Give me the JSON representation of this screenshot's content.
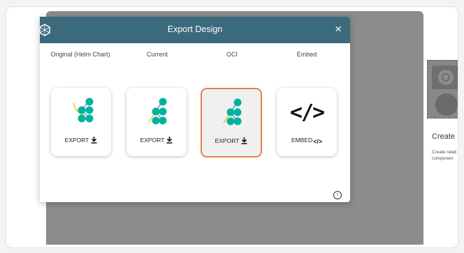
{
  "background": {
    "title": "Create R",
    "description_lines": [
      "Create relati",
      "componen"
    ]
  },
  "modal": {
    "title": "Export Design",
    "close_symbol": "×",
    "info_symbol": "i",
    "options": [
      {
        "label": "Original (Helm Chart)",
        "action": "EXPORT",
        "action_icon": "download-icon",
        "graphic": "meshery-logo-icon",
        "selected": false
      },
      {
        "label": "Current",
        "action": "EXPORT",
        "action_icon": "download-icon",
        "graphic": "meshery-logo-icon",
        "selected": false
      },
      {
        "label": "OCI",
        "action": "EXPORT",
        "action_icon": "download-icon",
        "graphic": "meshery-logo-icon",
        "selected": true
      },
      {
        "label": "Embed",
        "action": "EMBED",
        "action_icon": "code-icon",
        "graphic": "code-icon",
        "code_glyph": "</>",
        "selected": false
      }
    ]
  },
  "colors": {
    "header": "#3b6a7d",
    "selected_border": "#eb7d4a",
    "logo_teal": "#00b39f",
    "logo_gold": "#ebc017"
  }
}
